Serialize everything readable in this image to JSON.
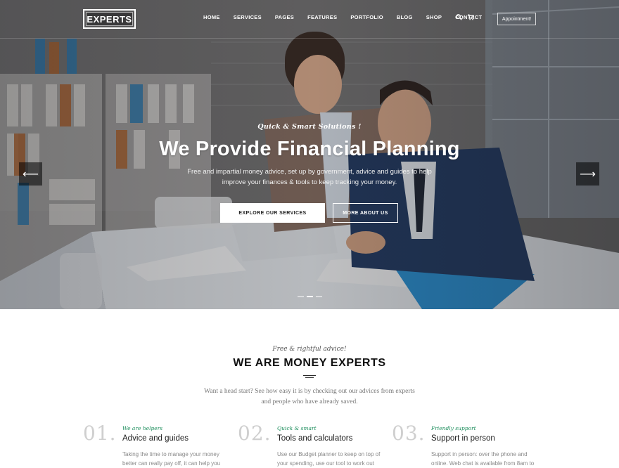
{
  "brand": {
    "logo_text": "EXPERTS"
  },
  "nav": {
    "items": [
      "HOME",
      "SERVICES",
      "PAGES",
      "FEATURES",
      "PORTFOLIO",
      "BLOG",
      "SHOP",
      "CONTACT"
    ],
    "search_icon": "search-icon",
    "cart_icon": "cart-icon",
    "appointment_label": "Appointment!"
  },
  "hero": {
    "kicker": "Quick & Smart Solutions !",
    "title": "We Provide Financial Planning",
    "desc_line1": "Free and impartial money advice, set up by government, advice and guides to help",
    "desc_line2": "improve your finances & tools to keep tracking your money.",
    "primary_button": "EXPLORE OUR SERVICES",
    "secondary_button": "MORE ABOUT US",
    "prev_arrow": "⟵",
    "next_arrow": "⟶",
    "slides": 3,
    "active_slide": 2
  },
  "about": {
    "kicker": "Free & rightful advice!",
    "title": "WE ARE MONEY EXPERTS",
    "desc_line1": "Want a head start? See how easy it is by checking out our advices from experts",
    "desc_line2": "and people who have already saved."
  },
  "features": [
    {
      "number": "01.",
      "kicker": "We are helpers",
      "title": "Advice and guides",
      "text": "Taking the time to manage your money better can really pay off, it can help you"
    },
    {
      "number": "02.",
      "kicker": "Quick & smart",
      "title": "Tools and calculators",
      "text": "Use our Budget planner to keep on top of your spending, use our tool to work out"
    },
    {
      "number": "03.",
      "kicker": "Friendly support",
      "title": "Support in person",
      "text": "Support in person: over the phone and online. Web chat is available from 8am to"
    }
  ],
  "colors": {
    "accent_green": "#1a8c5a",
    "hero_overlay": "#14161c"
  }
}
